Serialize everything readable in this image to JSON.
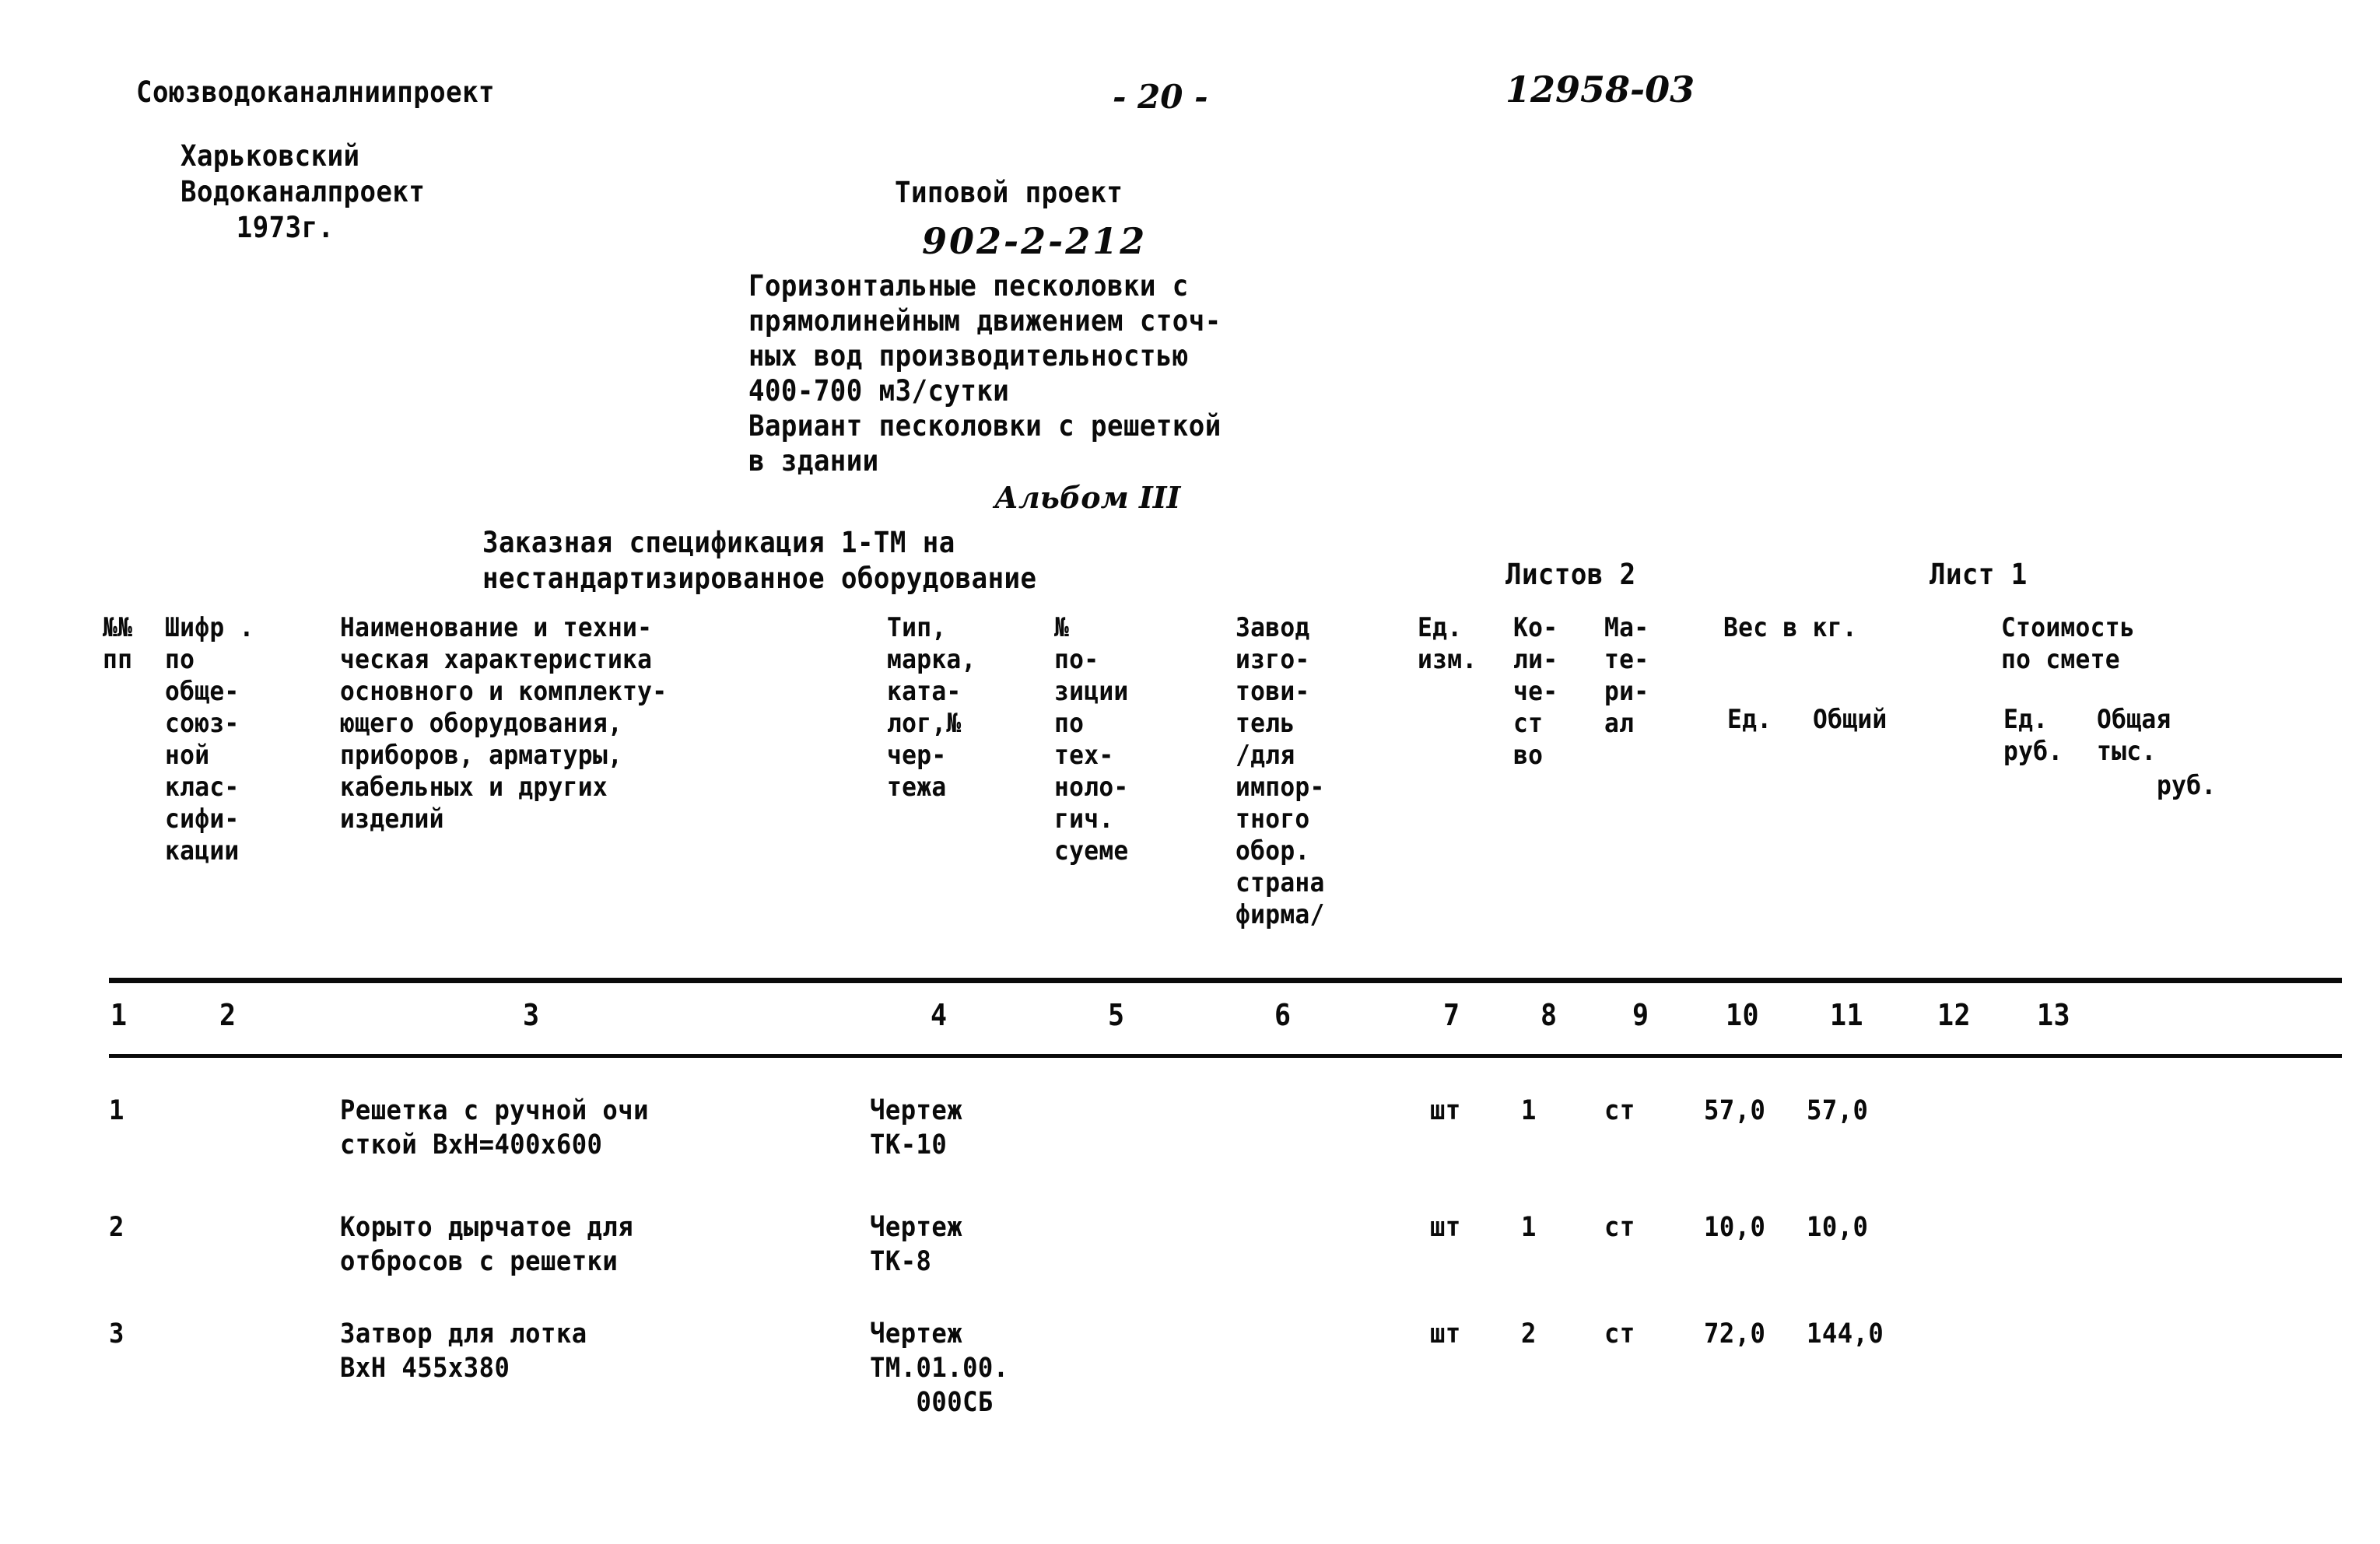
{
  "header": {
    "organization": "Союзводоканалниипроект",
    "branch_line1": "Харьковский",
    "branch_line2": "Водоканалпроект",
    "branch_year": "1973г.",
    "page_number": "- 20 -",
    "doc_code": "12958-03",
    "project_label": "Типовой проект",
    "project_code": "902-2-212",
    "project_description": "Горизонтальные песколовки с\nпрямолинейным движением сточ-\nных вод производительностью\n400-700 м3/сутки\nВариант песколовки с решеткой\nв здании",
    "album": "Альбом III",
    "spec_title": "Заказная спецификация 1-ТМ на\nнестандартизированное оборудование",
    "sheets_total": "Листов 2",
    "sheet_current": "Лист 1"
  },
  "table": {
    "headers": {
      "col1": "№№\nпп",
      "col2": "Шифр .\nпо\nобще-\nсоюз-\nной\nклас-\nсифи-\nкации",
      "col3": "Наименование и техни-\nческая характеристика\nосновного и комплекту-\nющего оборудования,\nприборов, арматуры,\nкабельных и других\nизделий",
      "col4": "Тип,\nмарка,\nката-\nлог,№\nчер-\nтежа",
      "col5": "№\nпо-\nзиции\nпо\nтех-\nноло-\nгич.\nсуеме",
      "col6": "Завод\nизго-\nтови-\nтель\n/для\nимпор-\nтного\nобор.\nстрана\nфирма/",
      "col7": "Ед.\nизм.",
      "col8": "Ко-\nли-\nче-\nст\nво",
      "col9": "Ма-\nте-\nри-\nал",
      "col10": "Вес в кг.",
      "col10_sub": "Ед.",
      "col11_sub": "Общий",
      "col12": "Стоимость\nпо смете",
      "col12_sub": "Ед.\nруб.",
      "col13_sub": "Общая\nтыс.",
      "col13_sub2": "руб."
    },
    "column_numbers": [
      "1",
      "2",
      "3",
      "4",
      "5",
      "6",
      "7",
      "8",
      "9",
      "10",
      "11",
      "12",
      "13"
    ],
    "rows": [
      {
        "num": "1",
        "shifr": "",
        "name": "Решетка с ручной очи\nсткой ВхН=400х600",
        "type": "Чертеж\nТК-10",
        "position": "",
        "manufacturer": "",
        "unit": "шт",
        "quantity": "1",
        "material": "ст",
        "weight_unit": "57,0",
        "weight_total": "57,0",
        "cost_unit": "",
        "cost_total": ""
      },
      {
        "num": "2",
        "shifr": "",
        "name": "Корыто дырчатое для\nотбросов с решетки",
        "type": "Чертеж\nТК-8",
        "position": "",
        "manufacturer": "",
        "unit": "шт",
        "quantity": "1",
        "material": "ст",
        "weight_unit": "10,0",
        "weight_total": "10,0",
        "cost_unit": "",
        "cost_total": ""
      },
      {
        "num": "3",
        "shifr": "",
        "name": "Затвор для лотка\nВхН 455х380",
        "type": "Чертеж\nТМ.01.00.\n   000СБ",
        "position": "",
        "manufacturer": "",
        "unit": "шт",
        "quantity": "2",
        "material": "ст",
        "weight_unit": "72,0",
        "weight_total": "144,0",
        "cost_unit": "",
        "cost_total": ""
      }
    ]
  }
}
